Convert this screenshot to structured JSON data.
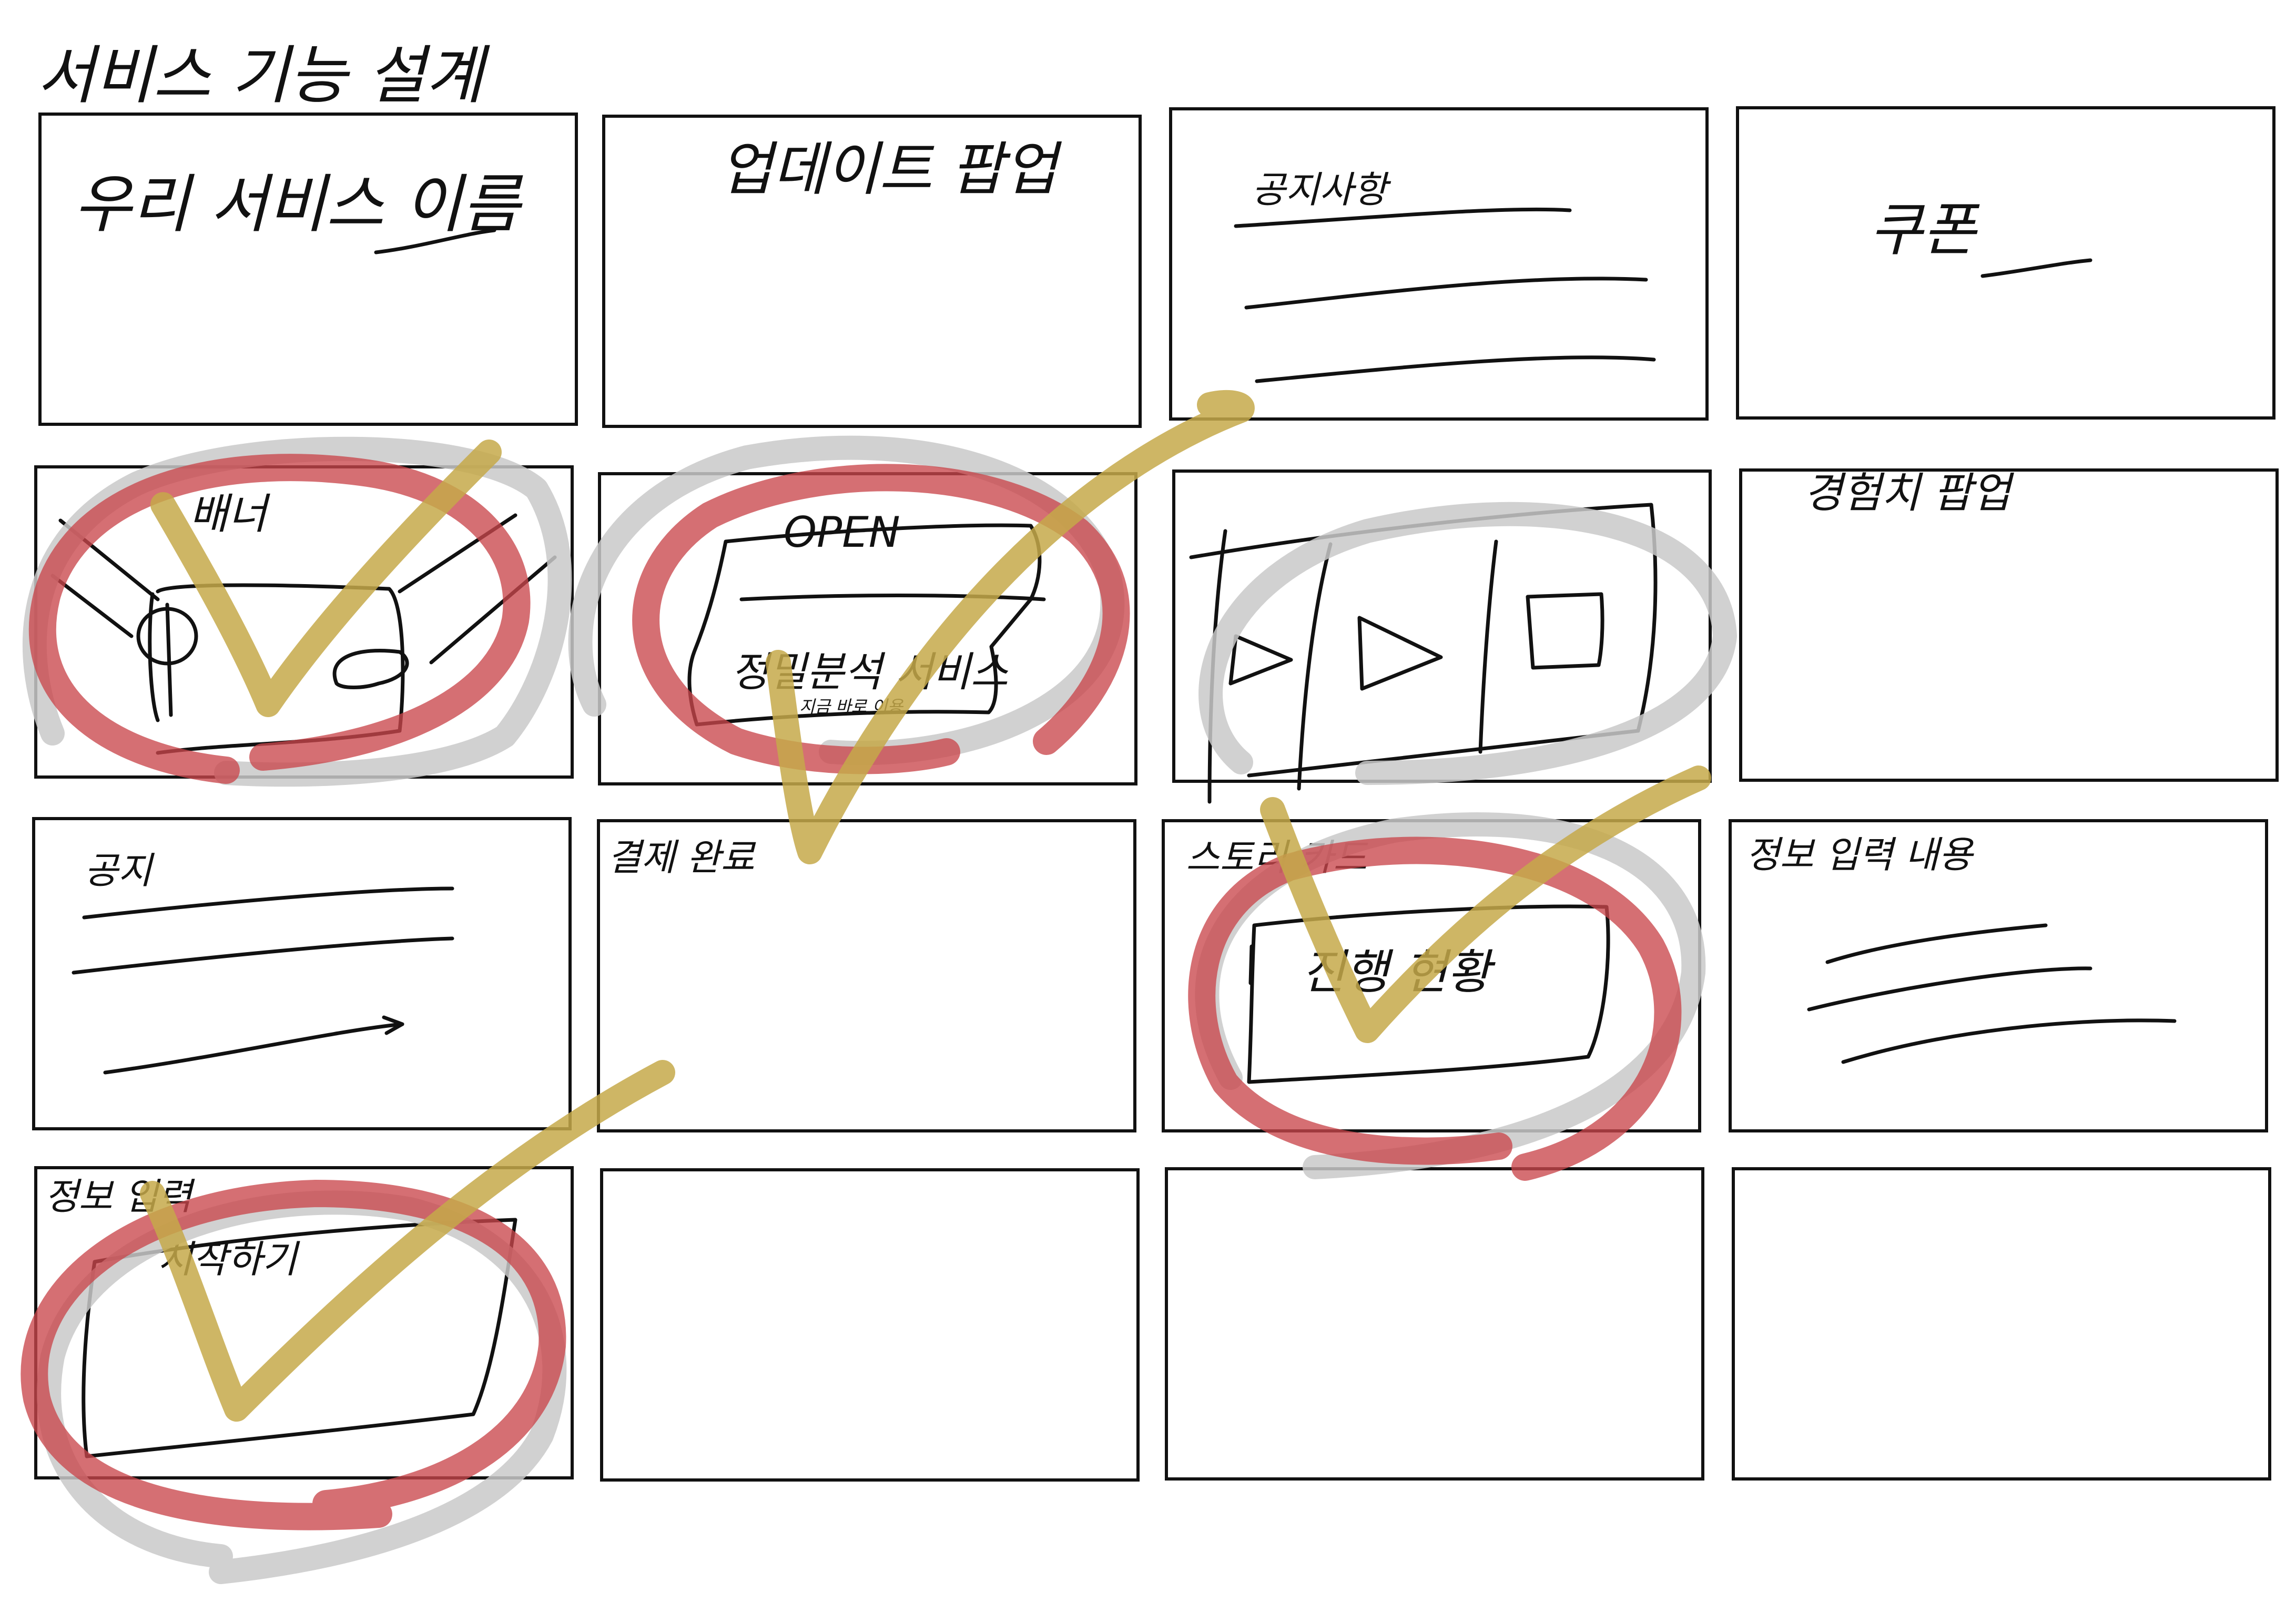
{
  "title": "서비스 기능 설계",
  "colors": {
    "ink": "#111111",
    "highlight_grey": "#c9c9c9",
    "circle_red": "#c9474c",
    "check_gold": "#c6a94a"
  },
  "panels": [
    {
      "label": "우리 서비스 이름",
      "selected": false
    },
    {
      "label": "업데이트 팝업",
      "selected": false
    },
    {
      "label": "공지사항",
      "selected": false
    },
    {
      "label": "쿠폰",
      "selected": false
    },
    {
      "label": "배너",
      "selected": true
    },
    {
      "label": "OPEN",
      "sub_label": "정밀분석 서비스",
      "tiny_label": "지금 바로 이용",
      "selected": true
    },
    {
      "label": "",
      "selected": true
    },
    {
      "label": "경험치 팝업",
      "selected": false
    },
    {
      "label": "공지",
      "selected": false
    },
    {
      "label": "결제 완료",
      "selected": false
    },
    {
      "label": "스토리 카드",
      "sub_label": "진행 현황",
      "selected": true
    },
    {
      "label": "정보 입력 내용",
      "selected": false
    },
    {
      "label": "정보 입력",
      "sub_label": "시작하기",
      "selected": true
    },
    {
      "label": "",
      "selected": false
    },
    {
      "label": "",
      "selected": false
    },
    {
      "label": "",
      "selected": false
    }
  ],
  "icons": {
    "annotation_circle": "hand-drawn-circle",
    "annotation_check": "hand-drawn-checkmark"
  }
}
